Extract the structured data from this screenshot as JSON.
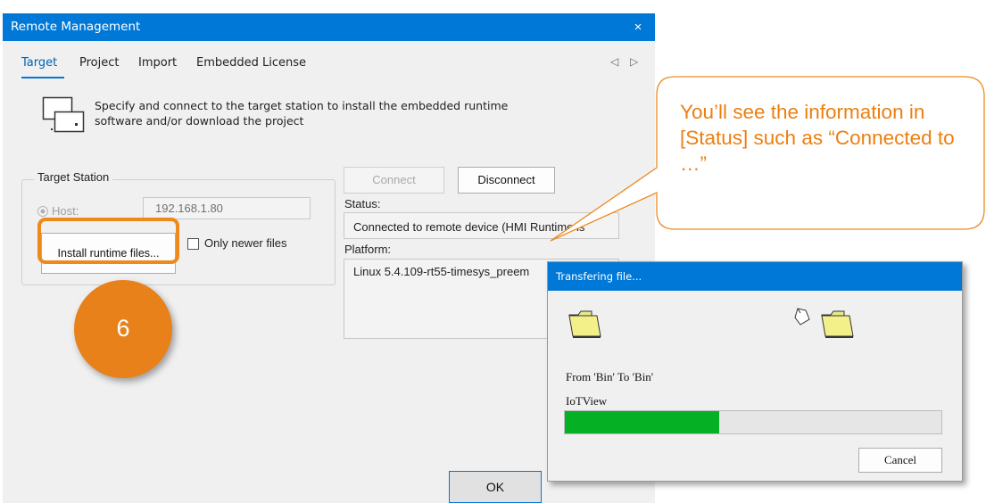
{
  "window": {
    "title": "Remote Management",
    "close_glyph": "×",
    "tabs": [
      {
        "label": "Target",
        "selected": true
      },
      {
        "label": "Project",
        "selected": false
      },
      {
        "label": "Import",
        "selected": false
      },
      {
        "label": "Embedded License",
        "selected": false
      }
    ],
    "tab_scroll_left": "◁",
    "tab_scroll_right": "▷",
    "description_line1": "Specify and connect to the target station to install the embedded runtime",
    "description_line2": "software and/or download the project",
    "target_station": {
      "group_title": "Target Station",
      "host_label": "Host:",
      "host_value": "192.168.1.80",
      "install_button": "Install runtime files...",
      "only_newer_label": "Only newer files",
      "only_newer_checked": false
    },
    "connect_button": "Connect",
    "disconnect_button": "Disconnect",
    "status_label": "Status:",
    "status_value": "Connected to remote device (HMI Runtime is",
    "platform_label": "Platform:",
    "platform_value": "Linux 5.4.109-rt55-timesys_preem",
    "ok_button": "OK"
  },
  "annotation": {
    "step_number": "6",
    "callout_text": "You’ll see the information in [Status] such as “Connected to …”",
    "accent_color": "#ee8a1c"
  },
  "transfer_dialog": {
    "title": "Transfering file...",
    "from_to_text": "From 'Bin' To 'Bin'",
    "file_name": "IoTView",
    "progress_fraction": 0.41,
    "cancel_button": "Cancel",
    "progress_color": "#06b025"
  }
}
